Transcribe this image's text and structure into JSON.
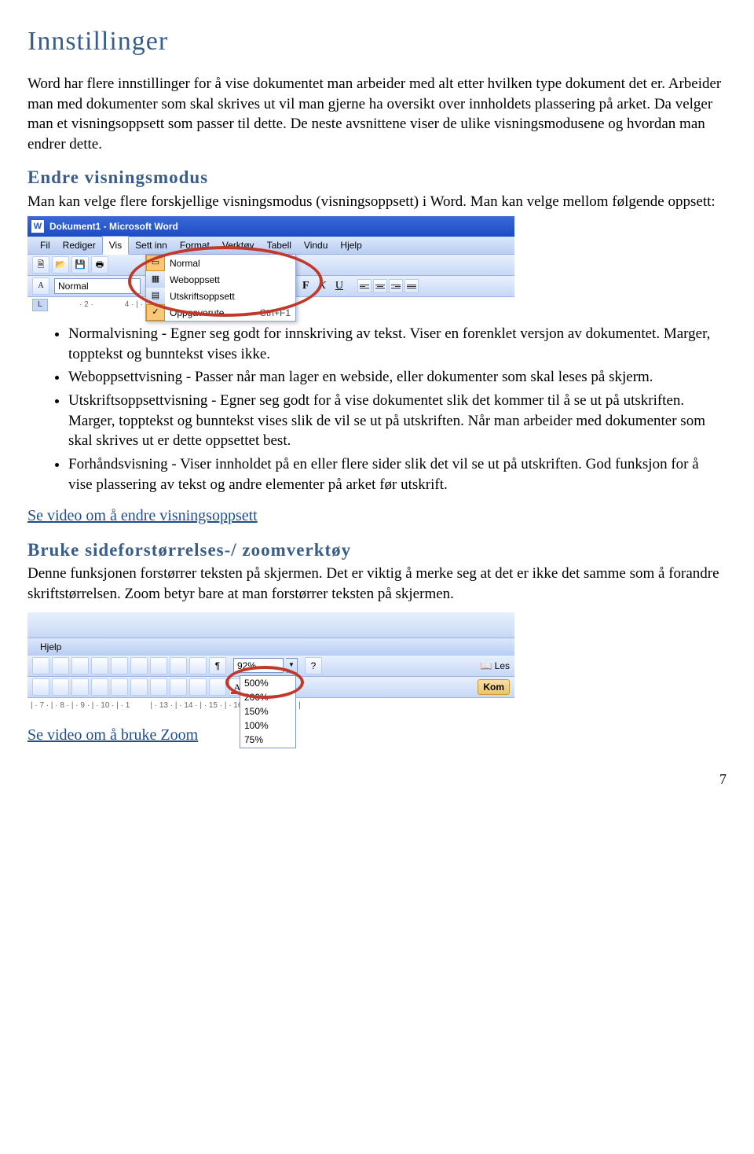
{
  "h1": "Innstillinger",
  "intro1": "Word har flere innstillinger for å vise dokumentet man arbeider med alt etter hvilken type dokument det er. Arbeider man med dokumenter som skal skrives ut vil man gjerne ha oversikt over innholdets plassering på arket. Da velger man et visningsoppsett som passer til dette. De neste avsnittene viser de ulike visningsmodusene og hvordan man endrer dette.",
  "h2a": "Endre visningsmodus",
  "p2": "Man kan velge flere forskjellige visningsmodus (visningsoppsett) i Word. Man kan velge mellom følgende oppsett:",
  "shot1": {
    "title": "Dokument1 - Microsoft Word",
    "menu": [
      "Fil",
      "Rediger",
      "Vis",
      "Sett inn",
      "Format",
      "Verktøy",
      "Tabell",
      "Vindu",
      "Hjelp"
    ],
    "open_menu_index": 2,
    "dropdown": [
      {
        "icon": "▭",
        "label": "Normal",
        "selected": true
      },
      {
        "icon": "▦",
        "label": "Weboppsett"
      },
      {
        "icon": "▤",
        "label": "Utskriftsoppsett"
      },
      {
        "icon": "✓",
        "label": "Oppgaverute",
        "shortcut": "Ctrl+F1",
        "checked": true
      }
    ],
    "stylebox": "Normal",
    "ruler_label": "L",
    "ruler_ticks": [
      "· 2 ·",
      "|",
      "",
      "4 · | · 5 · | · 6 · | · 7 · | · 8 · | · 9 · | · 10 · |"
    ],
    "fku": {
      "f": "F",
      "k": "K",
      "u": "U"
    }
  },
  "bullets": [
    "Normalvisning - Egner seg godt for innskriving av tekst. Viser en forenklet versjon av dokumentet. Marger, topptekst og bunntekst vises ikke.",
    "Weboppsettvisning - Passer når man lager en webside, eller dokumenter som skal leses på skjerm.",
    "Utskriftsoppsettvisning - Egner seg godt for å vise dokumentet slik det kommer til å se ut på utskriften. Marger, topptekst og bunntekst vises slik de vil se ut på utskriften. Når man arbeider med dokumenter som skal skrives ut er dette oppsettet best.",
    "Forhåndsvisning - Viser innholdet på en eller flere sider slik det vil se ut på utskriften. God funksjon for å vise plassering av tekst og andre elementer på arket før utskrift."
  ],
  "link1": "Se video om å endre visningsoppsett",
  "h2b": "Bruke sideforstørrelses-/ zoomverktøy",
  "p3": "Denne funksjonen forstørrer teksten på skjermen. Det er viktig å merke seg at det er ikke det samme som å forandre skriftstørrelsen. Zoom betyr bare at man forstørrer teksten på skjermen.",
  "shot2": {
    "menu": [
      "Hjelp"
    ],
    "zoom_value": "92%",
    "zoom_options": [
      "500%",
      "200%",
      "150%",
      "100%",
      "75%"
    ],
    "les_label": "Les",
    "kom_label": "Kom",
    "ruler": [
      "| · 7 · | · 8 · | · 9 · | · 10 · | · 1",
      "| · 13 · | · 14 · | · 15 · | · 16 · | · 17 · | · 18 · |"
    ]
  },
  "link2": "Se video om å bruke Zoom",
  "page_num": "7"
}
